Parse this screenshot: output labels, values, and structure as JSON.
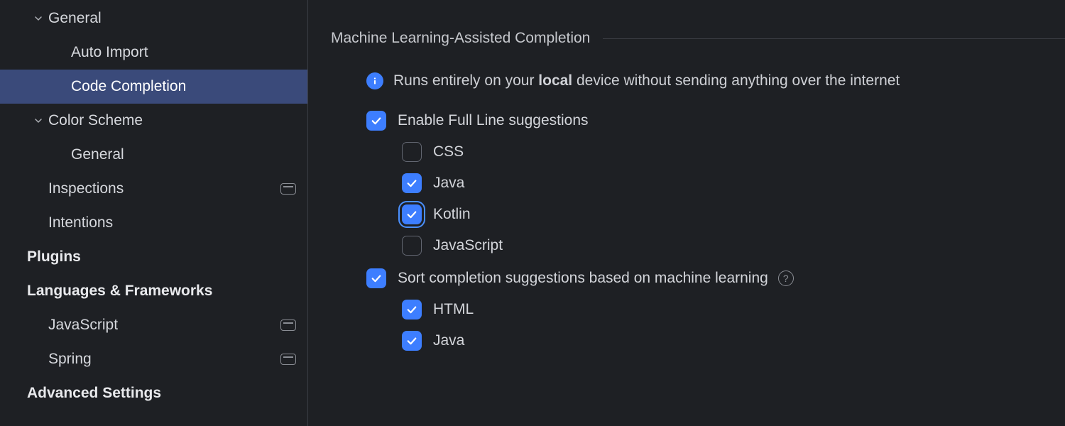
{
  "sidebar": {
    "items": [
      {
        "label": "General",
        "indent": 1,
        "chevron": true,
        "bold": false,
        "badge": false,
        "selected": false
      },
      {
        "label": "Auto Import",
        "indent": 2,
        "chevron": false,
        "bold": false,
        "badge": false,
        "selected": false
      },
      {
        "label": "Code Completion",
        "indent": 2,
        "chevron": false,
        "bold": false,
        "badge": false,
        "selected": true
      },
      {
        "label": "Color Scheme",
        "indent": 1,
        "chevron": true,
        "bold": false,
        "badge": false,
        "selected": false
      },
      {
        "label": "General",
        "indent": 2,
        "chevron": false,
        "bold": false,
        "badge": false,
        "selected": false
      },
      {
        "label": "Inspections",
        "indent": 1,
        "chevron": false,
        "bold": false,
        "badge": true,
        "selected": false
      },
      {
        "label": "Intentions",
        "indent": 1,
        "chevron": false,
        "bold": false,
        "badge": false,
        "selected": false
      },
      {
        "label": "Plugins",
        "indent": 0,
        "chevron": false,
        "bold": true,
        "badge": false,
        "selected": false
      },
      {
        "label": "Languages & Frameworks",
        "indent": 0,
        "chevron": false,
        "bold": true,
        "badge": false,
        "selected": false
      },
      {
        "label": "JavaScript",
        "indent": 1,
        "chevron": false,
        "bold": false,
        "badge": true,
        "selected": false
      },
      {
        "label": "Spring",
        "indent": 1,
        "chevron": false,
        "bold": false,
        "badge": true,
        "selected": false
      },
      {
        "label": "Advanced Settings",
        "indent": 0,
        "chevron": false,
        "bold": true,
        "badge": false,
        "selected": false
      }
    ]
  },
  "main": {
    "section_title": "Machine Learning-Assisted Completion",
    "info_pre": "Runs entirely on your ",
    "info_bold": "local",
    "info_post": " device without sending anything over the internet",
    "enable_full_line": {
      "label": "Enable Full Line suggestions",
      "checked": true,
      "focused": false
    },
    "languages_full_line": [
      {
        "label": "CSS",
        "checked": false,
        "focused": false
      },
      {
        "label": "Java",
        "checked": true,
        "focused": false
      },
      {
        "label": "Kotlin",
        "checked": true,
        "focused": true
      },
      {
        "label": "JavaScript",
        "checked": false,
        "focused": false
      }
    ],
    "sort_ml": {
      "label": "Sort completion suggestions based on machine learning",
      "checked": true,
      "help": true
    },
    "languages_sort": [
      {
        "label": "HTML",
        "checked": true
      },
      {
        "label": "Java",
        "checked": true
      }
    ]
  }
}
